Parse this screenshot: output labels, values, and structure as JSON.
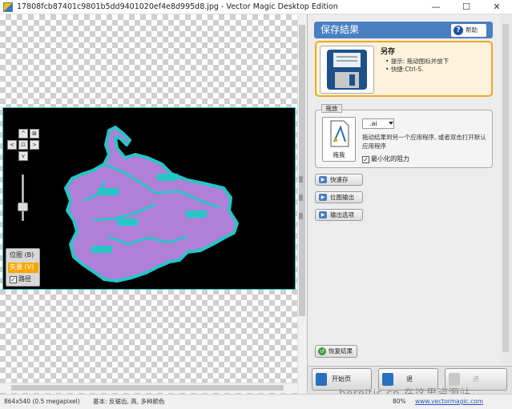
{
  "window": {
    "title": "17808fcb87401c9801b5dd9401020ef4e8d995d8.jpg - Vector Magic Desktop Edition",
    "minimize": "—",
    "maximize": "☐",
    "close": "✕"
  },
  "canvas": {
    "zoom_buttons": {
      "up": "^",
      "left": "<",
      "right": ">",
      "down": "v",
      "fit": "⊠",
      "center": "⊡"
    },
    "view_options": {
      "bitmap": "位图 (B)",
      "vector": "矢量 (V)",
      "edges": "路径"
    },
    "edges_checked": "✓"
  },
  "panel": {
    "header": "保存結果",
    "help": "帮助",
    "help_glyph": "?",
    "save": {
      "title": "另存",
      "hint": "提示: 拖动图标并放下",
      "shortcut": "快捷:Ctrl-S."
    },
    "drag": {
      "legend": "拖放",
      "icon_label": "拖我",
      "format": ".ai",
      "description": "拖动结果到另一个应用程序, 或者双击打开默认应用程序",
      "minimize_label": "最小化的阻力",
      "minimize_checked": "✓"
    },
    "actions": [
      "快速存",
      "位图输出",
      "输出选项"
    ],
    "revert": "恢复结果",
    "nav": {
      "home": "开始页",
      "back": "退",
      "next": "进"
    }
  },
  "status": {
    "info": "864x540 (0.5 megapixel)",
    "mode": "基本: 反锯齿, 高, 多种颜色",
    "zoom": "80%",
    "link": "www.vectormagic.com"
  },
  "watermark": "hereitis.cn 在这里资源站",
  "colors": {
    "accent": "#4a7fc1",
    "highlight": "#f2a818",
    "map_fill": "#b07fd8",
    "map_edge": "#25c6c6"
  }
}
